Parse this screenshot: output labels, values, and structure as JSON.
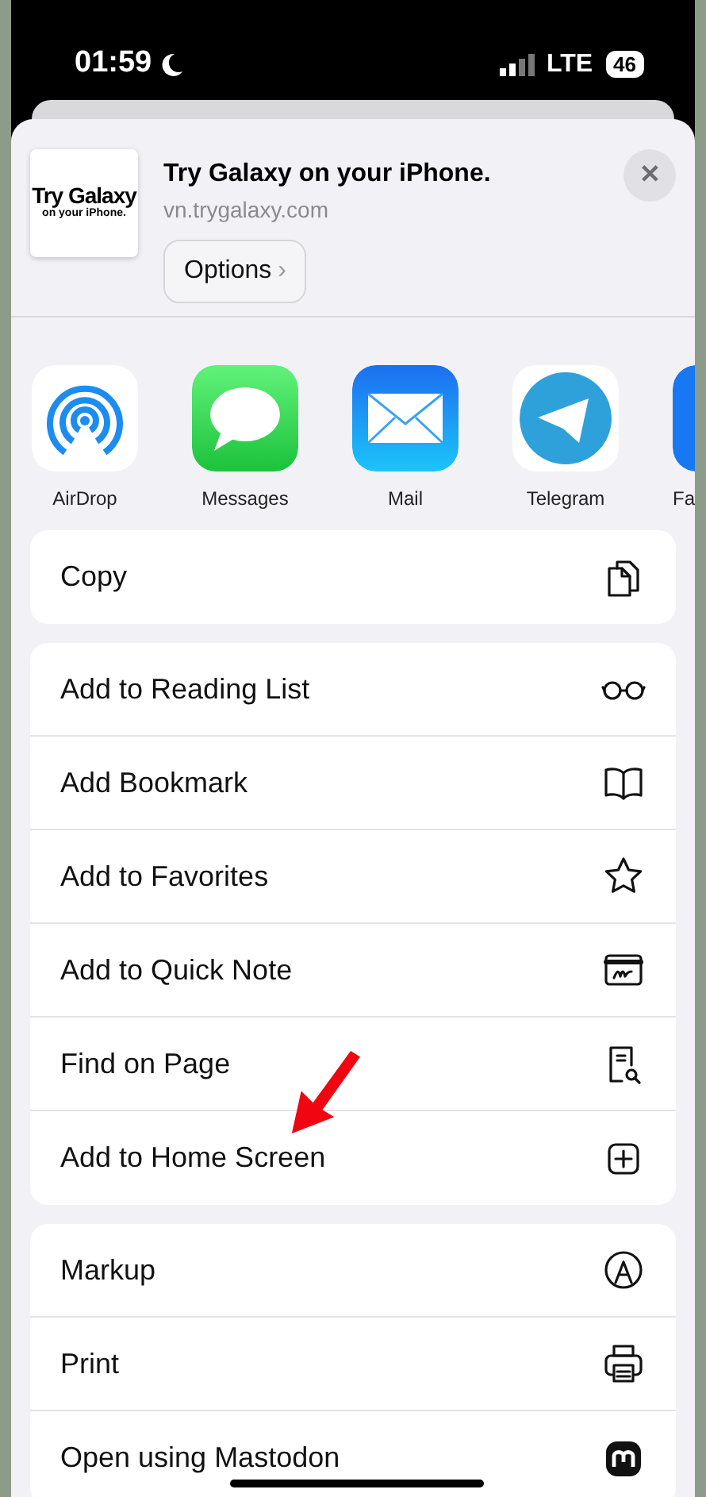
{
  "status_bar": {
    "time": "01:59",
    "network": "LTE",
    "battery": "46"
  },
  "header": {
    "thumbnail_title": "Try Galaxy",
    "thumbnail_subtitle": "on your iPhone.",
    "title": "Try Galaxy on your iPhone.",
    "url": "vn.trygalaxy.com",
    "options_button": "Options",
    "chevron": "›",
    "close": "✕"
  },
  "apps": [
    {
      "label": "AirDrop",
      "kind": "airdrop"
    },
    {
      "label": "Messages",
      "kind": "messages"
    },
    {
      "label": "Mail",
      "kind": "mail"
    },
    {
      "label": "Telegram",
      "kind": "telegram"
    },
    {
      "label": "Fa",
      "kind": "partial"
    }
  ],
  "action_groups": [
    [
      {
        "label": "Copy",
        "kind": "copy"
      }
    ],
    [
      {
        "label": "Add to Reading List",
        "kind": "glasses"
      },
      {
        "label": "Add Bookmark",
        "kind": "book"
      },
      {
        "label": "Add to Favorites",
        "kind": "star"
      },
      {
        "label": "Add to Quick Note",
        "kind": "quicknote"
      },
      {
        "label": "Find on Page",
        "kind": "find"
      },
      {
        "label": "Add to Home Screen",
        "kind": "plus"
      }
    ],
    [
      {
        "label": "Markup",
        "kind": "markup"
      },
      {
        "label": "Print",
        "kind": "print"
      },
      {
        "label": "Open using Mastodon",
        "kind": "mastodon"
      }
    ]
  ]
}
